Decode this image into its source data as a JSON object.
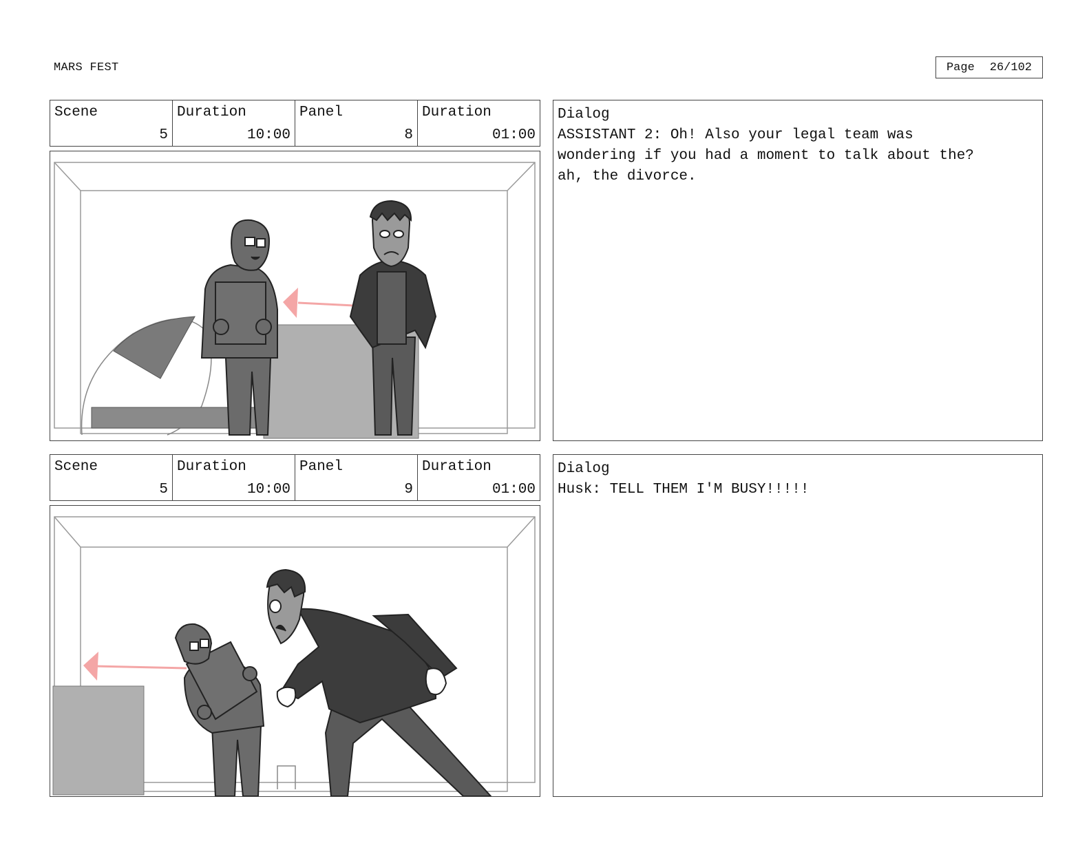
{
  "header": {
    "project_title": "MARS FEST",
    "page_label": "Page",
    "page_number": "26/102"
  },
  "panels": [
    {
      "scene_label": "Scene",
      "scene_value": "5",
      "scene_duration_label": "Duration",
      "scene_duration_value": "10:00",
      "panel_label": "Panel",
      "panel_value": "8",
      "panel_duration_label": "Duration",
      "panel_duration_value": "01:00",
      "dialog_label": "Dialog",
      "dialog_text": "ASSISTANT 2: Oh! Also your legal team was\nwondering if you had a moment to talk about the?\nah, the divorce."
    },
    {
      "scene_label": "Scene",
      "scene_value": "5",
      "scene_duration_label": "Duration",
      "scene_duration_value": "10:00",
      "panel_label": "Panel",
      "panel_value": "9",
      "panel_duration_label": "Duration",
      "panel_duration_value": "01:00",
      "dialog_label": "Dialog",
      "dialog_text": "Husk: TELL THEM I'M BUSY!!!!!"
    }
  ],
  "colors": {
    "motion_arrow": "#f4a6a6",
    "character_dark": "#3c3c3c",
    "character_mid": "#6b6b6b",
    "prop_light": "#b0b0b0"
  }
}
